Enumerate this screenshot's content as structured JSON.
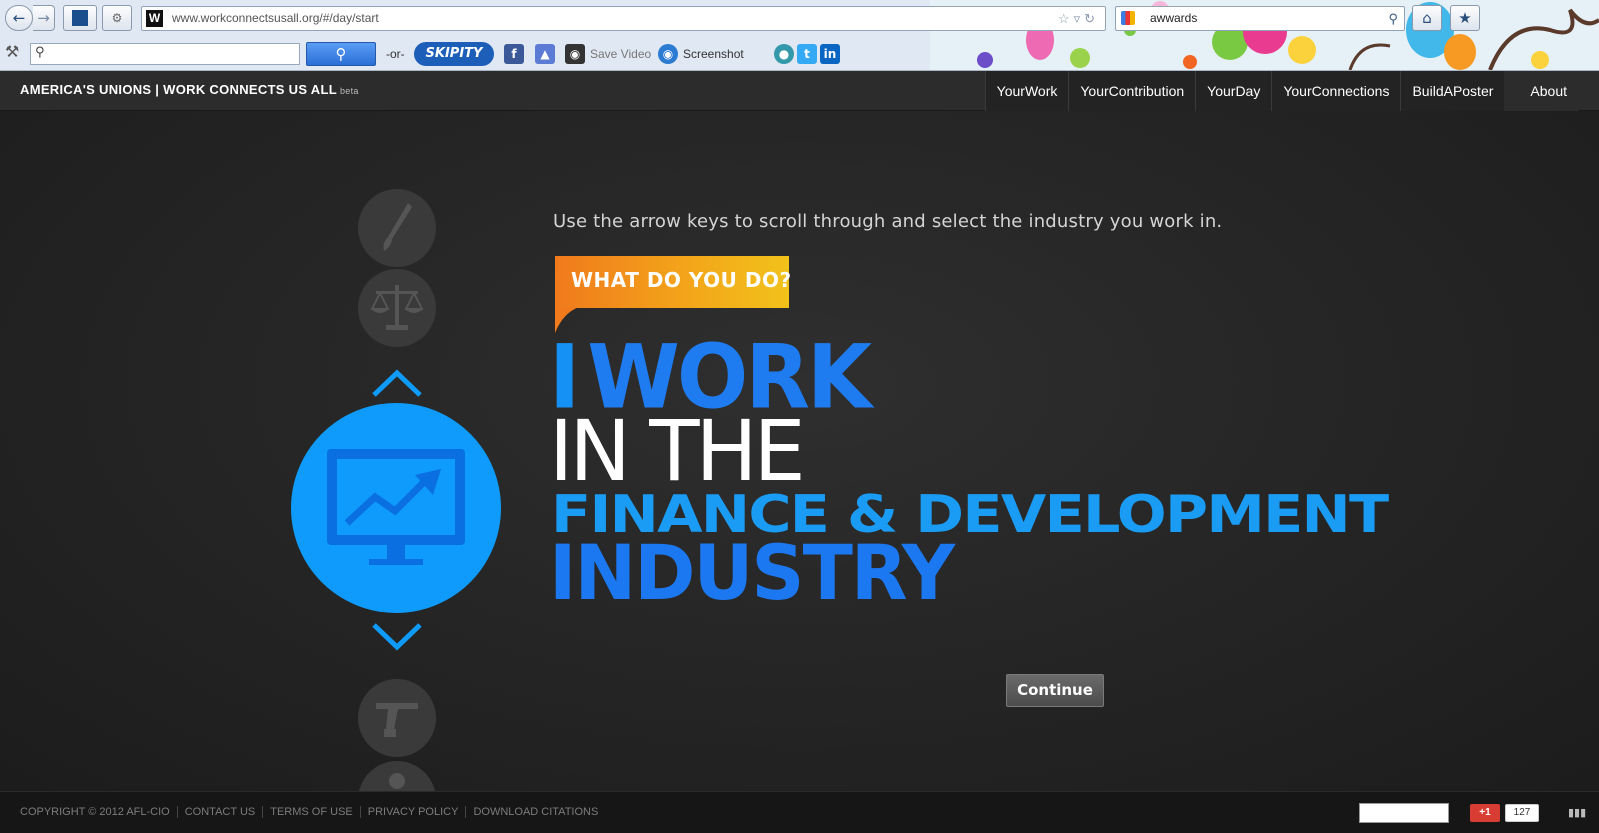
{
  "browser": {
    "url": "www.workconnectsusall.org/#/day/start",
    "search_query": "awwards",
    "toolbar": {
      "or_label": "-or-",
      "skipity_label": "SKIPITY",
      "save_video_label": "Save Video",
      "screenshot_label": "Screenshot"
    },
    "favicon_letter": "W"
  },
  "header": {
    "brand": "AMERICA'S UNIONS | WORK CONNECTS US ALL",
    "beta": "beta",
    "nav": [
      "YourWork",
      "YourContribution",
      "YourDay",
      "YourConnections",
      "BuildAPoster",
      "About"
    ]
  },
  "main": {
    "instructions": "Use the arrow keys to scroll through and select the industry you work in.",
    "badge": "WHAT DO YOU DO?",
    "headline": {
      "i": "I",
      "work": "WORK",
      "in_the": "IN THE",
      "industry_name": "FINANCE & DEVELOPMENT",
      "industry": "INDUSTRY"
    },
    "continue_label": "Continue",
    "industry_icons": [
      "brush-icon",
      "scales-icon",
      "monitor-chart-icon",
      "tool-icon",
      "gear-icon"
    ],
    "accent_color": "#0f9bfb",
    "badge_color": "#f3a41a"
  },
  "footer": {
    "links": [
      "COPYRIGHT © 2012 AFL-CIO",
      "CONTACT US",
      "TERMS OF USE",
      "PRIVACY POLICY",
      "DOWNLOAD CITATIONS"
    ],
    "gplus_label": "+1",
    "gplus_count": "127"
  }
}
